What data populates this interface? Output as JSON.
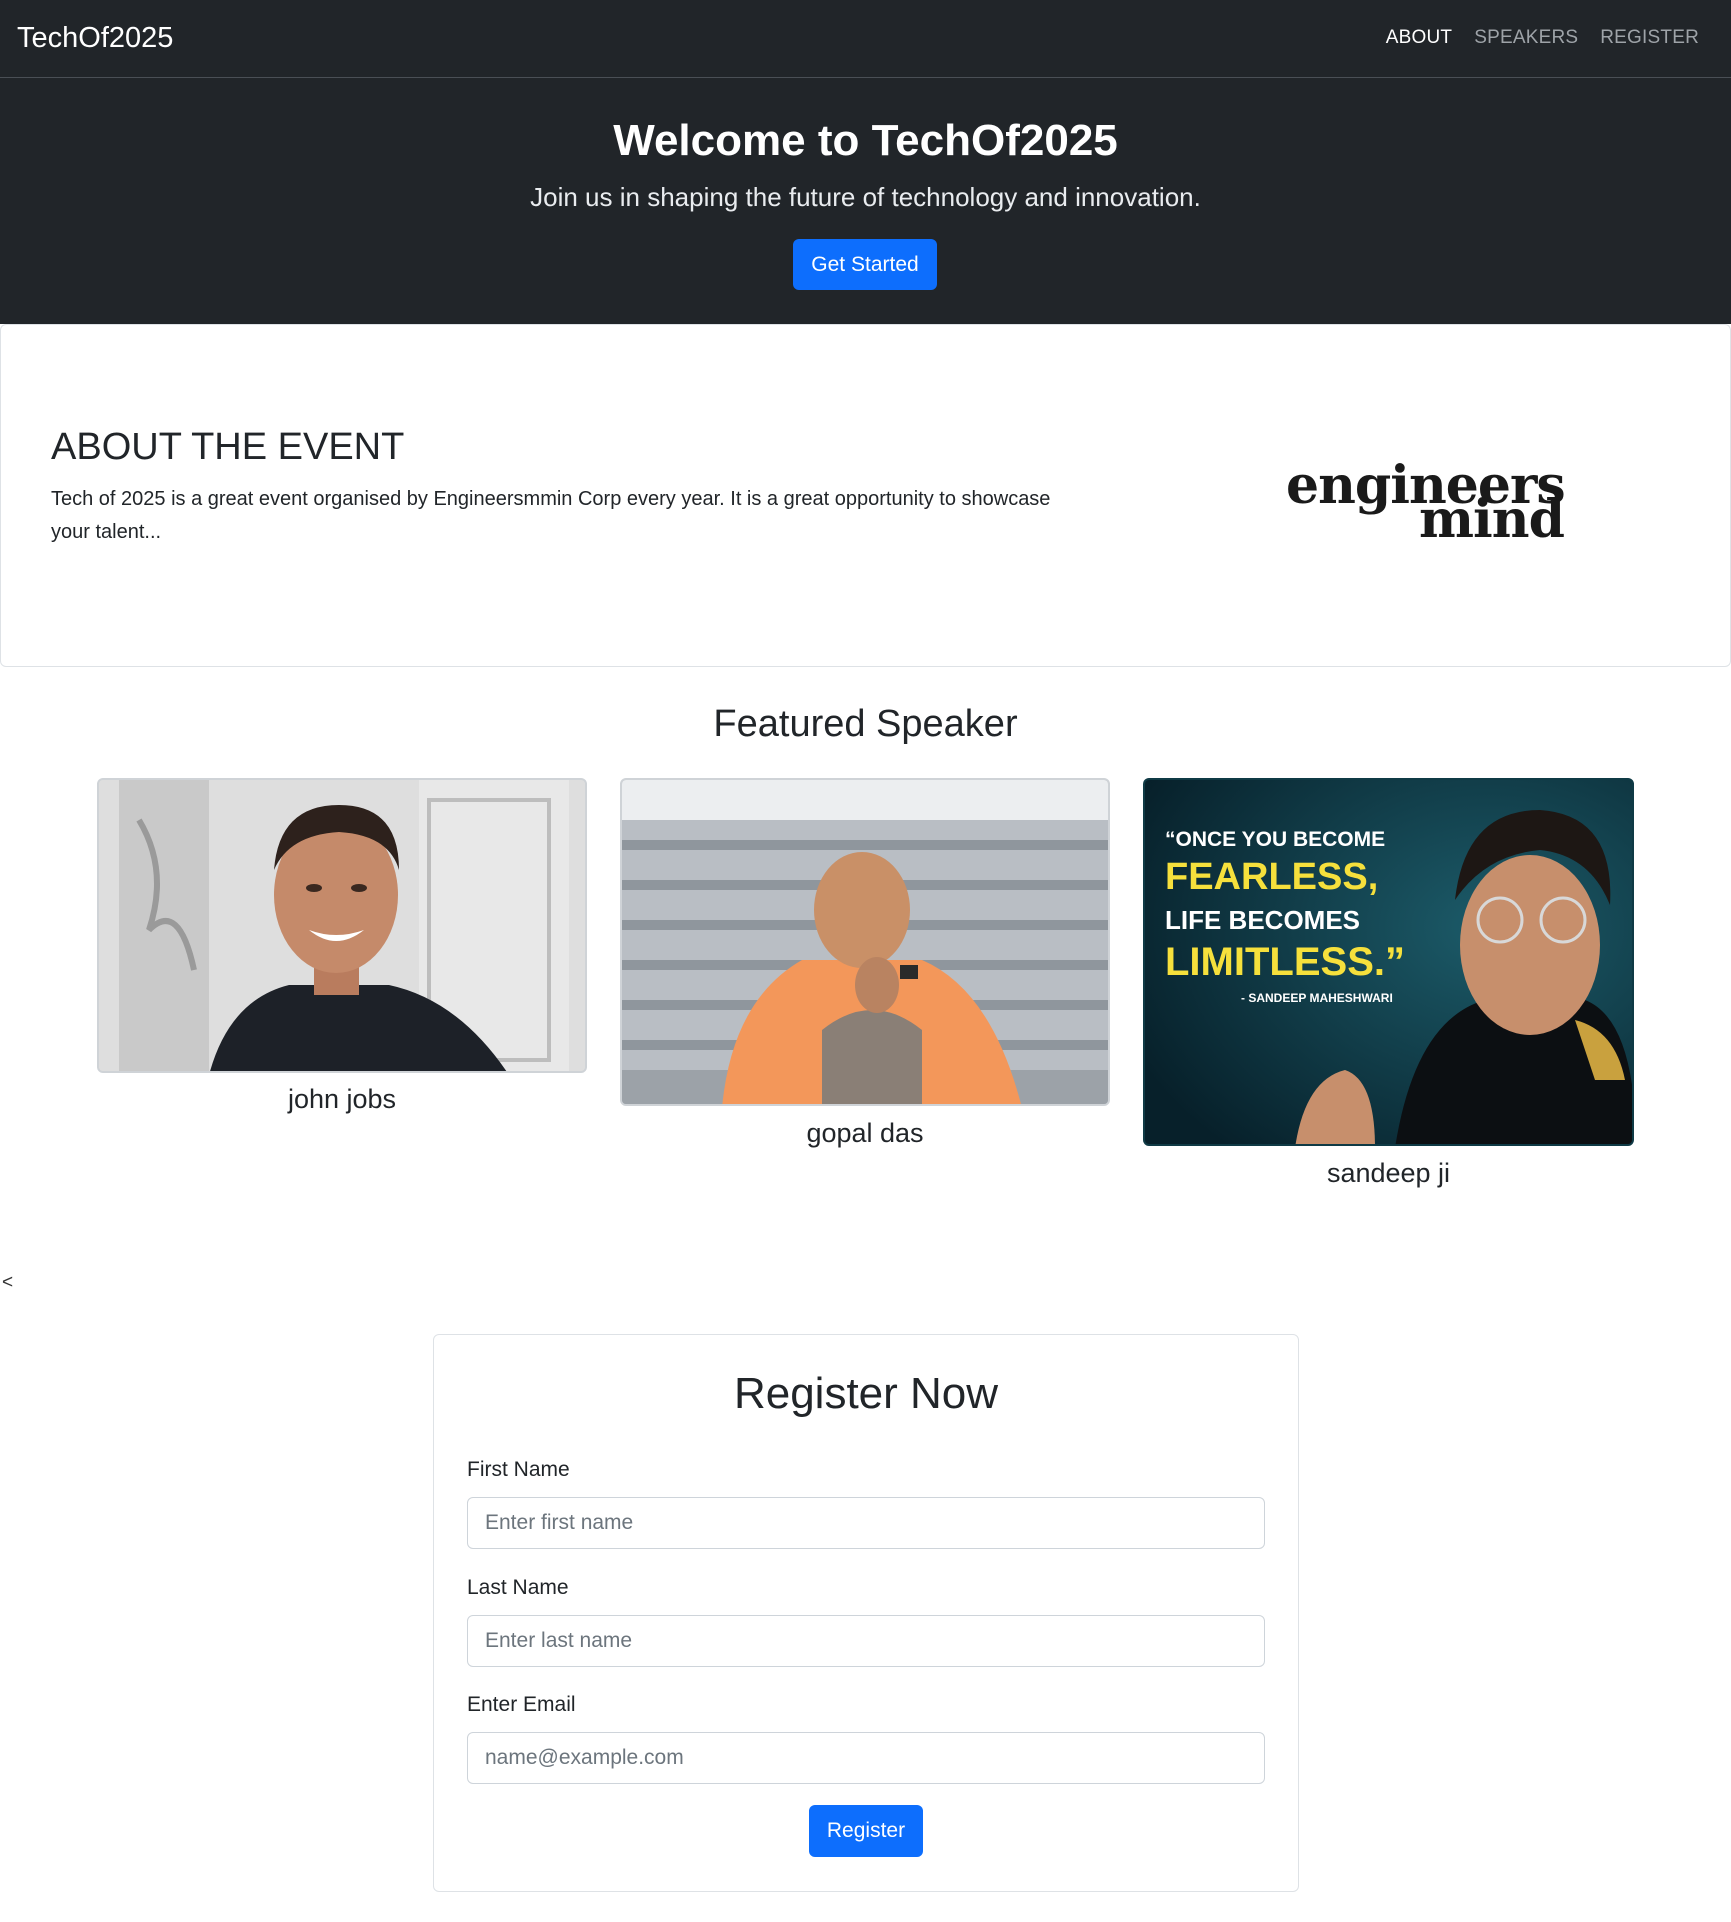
{
  "navbar": {
    "brand": "TechOf2025",
    "links": [
      "ABOUT",
      "SPEAKERS",
      "REGISTER"
    ]
  },
  "hero": {
    "title": "Welcome to TechOf2025",
    "subtitle": "Join us in shaping the future of technology and innovation.",
    "cta_label": "Get Started"
  },
  "about": {
    "title": "ABOUT THE EVENT",
    "text": "Tech of 2025 is a great event organised by Engineersmmin Corp every year. It is a great opportunity to showcase your talent...",
    "logo_line1": "engineers",
    "logo_line2": "mind"
  },
  "speakers": {
    "title": "Featured Speaker",
    "items": [
      {
        "name": "john jobs"
      },
      {
        "name": "gopal das"
      },
      {
        "name": "sandeep ji",
        "quote": [
          "“ONCE YOU BECOME",
          "FEARLESS,",
          "LIFE BECOMES",
          "LIMITLESS.”",
          "- SANDEEP MAHESHWARI"
        ]
      }
    ]
  },
  "carousel": {
    "prev_label": "<"
  },
  "register": {
    "title": "Register Now",
    "first_name_label": "First Name",
    "first_name_placeholder": "Enter first name",
    "last_name_label": "Last Name",
    "last_name_placeholder": "Enter last name",
    "email_label": "Enter Email",
    "email_placeholder": "name@example.com",
    "submit_label": "Register"
  },
  "colors": {
    "navbar_bg": "#212529",
    "primary": "#0d6efd",
    "quote_highlight": "#f6e03c",
    "speaker3_bg": "#0f3a45"
  }
}
